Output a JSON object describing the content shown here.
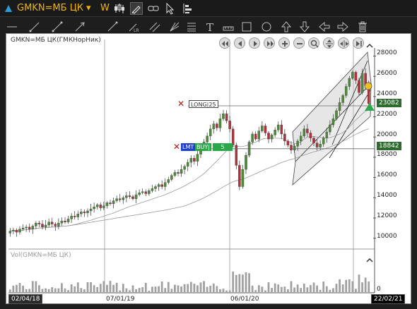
{
  "window": {
    "title": "GMKN=МБ ЦК",
    "caret": "▾",
    "timeframe": "W"
  },
  "toolbar_icons": [
    "candles-icon",
    "pen-icon",
    "link-icon",
    "cursor-icon",
    "levels-icon"
  ],
  "draw_tools": [
    "hline-icon",
    "ray-icon",
    "trendline-icon",
    "arrow-line-icon",
    "regression-icon",
    "parallel-channel-icon",
    "fibonacci-icon",
    "text-icon",
    "measure-icon",
    "rectangle-icon",
    "ellipse-icon",
    "arrow-up-icon",
    "arrow-down-icon",
    "arrow-left-icon",
    "arrow-right-icon",
    "trash-icon"
  ],
  "chart": {
    "legend": "GMKN=МБ ЦК(ГМКНорНик)",
    "volume_legend": "Vol(GMKN=МБ ЦК)",
    "y_ticks": [
      "28000",
      "26000",
      "24000",
      "22000",
      "20000",
      "18000",
      "16000",
      "14000",
      "12000",
      "10000"
    ],
    "volume_zero_label": "0",
    "x_labels": [
      "07/01/19",
      "06/01/20"
    ],
    "start_date": "02/04/18",
    "end_date": "22/02/21",
    "current_price": "23082",
    "order_price": "18842",
    "long_label": "LONG|25",
    "lmt_label": "LMT",
    "buy_label": "BUY|",
    "buy_qty": "5",
    "colors": {
      "up": "#4f8a3a",
      "down": "#b0323c",
      "accent": "#f0b400",
      "current_tag": "#2e6b2e",
      "order_tag": "#2e6b2e",
      "lmt_bg": "#1f3fcf",
      "buy_bg": "#2ca84a"
    }
  },
  "chart_data": {
    "type": "candlestick",
    "x_range": [
      "02/04/18",
      "22/02/21"
    ],
    "ylim": [
      9000,
      28800
    ],
    "y_ticks": [
      10000,
      12000,
      14000,
      16000,
      18000,
      20000,
      22000,
      24000,
      26000,
      28000
    ],
    "closes": [
      10700,
      10800,
      10600,
      10900,
      11000,
      11100,
      10900,
      11200,
      11500,
      11400,
      11100,
      11300,
      11600,
      11400,
      11200,
      11500,
      11700,
      11600,
      11900,
      12200,
      12100,
      12400,
      12600,
      12500,
      12700,
      12900,
      13100,
      13300,
      13000,
      13200,
      13500,
      13400,
      13700,
      13900,
      13800,
      14000,
      14200,
      14100,
      13900,
      14300,
      14500,
      14600,
      14400,
      14700,
      14900,
      15100,
      15300,
      15100,
      15500,
      15800,
      16200,
      16500,
      16400,
      16800,
      17100,
      17500,
      17900,
      17600,
      18300,
      18800,
      19500,
      20100,
      20800,
      21300,
      20900,
      21800,
      22300,
      21600,
      20800,
      19200,
      17200,
      15100,
      16800,
      18200,
      19500,
      20300,
      19800,
      20600,
      21100,
      20400,
      19800,
      20200,
      20700,
      21200,
      20300,
      19600,
      19200,
      18700,
      19100,
      19600,
      20100,
      20800,
      20400,
      19900,
      19400,
      19000,
      19300,
      19900,
      20500,
      21200,
      21800,
      22600,
      23400,
      24100,
      25000,
      25800,
      26400,
      25600,
      24400,
      26300,
      25100,
      23300
    ],
    "current_price": 23082,
    "order_price": 18842,
    "volume_max_label": 0
  }
}
